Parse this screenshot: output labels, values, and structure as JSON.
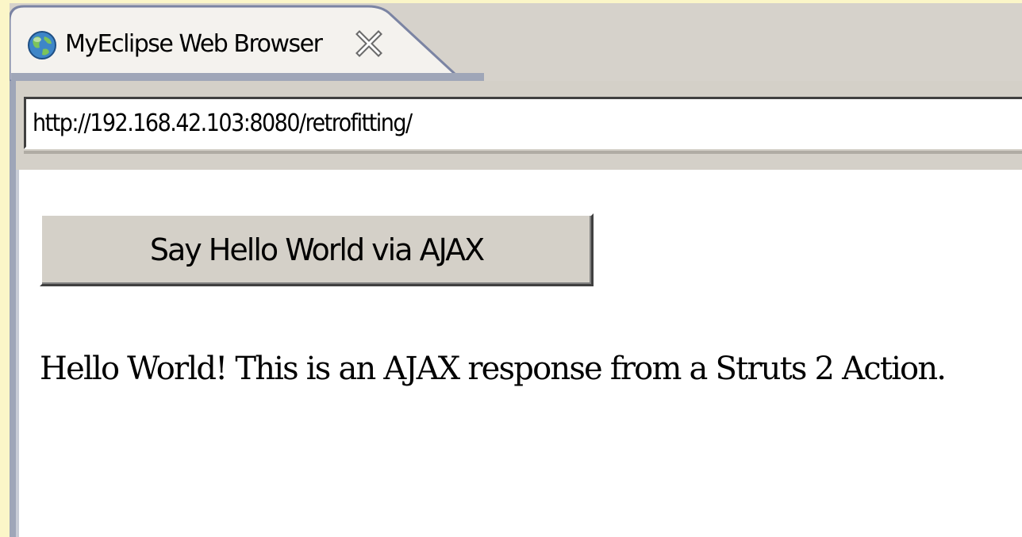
{
  "tab": {
    "title": "MyEclipse Web Browser",
    "icon": "globe-icon",
    "close_icon": "close-icon"
  },
  "address_bar": {
    "value": "http://192.168.42.103:8080/retrofitting/"
  },
  "page": {
    "button_label": "Say Hello World via AJAX",
    "response_text": "Hello World! This is an AJAX response from a Struts 2 Action."
  },
  "colors": {
    "tab_border": "#7b84a3",
    "chrome": "#d4d0c8",
    "page_bg": "#ffffff"
  }
}
